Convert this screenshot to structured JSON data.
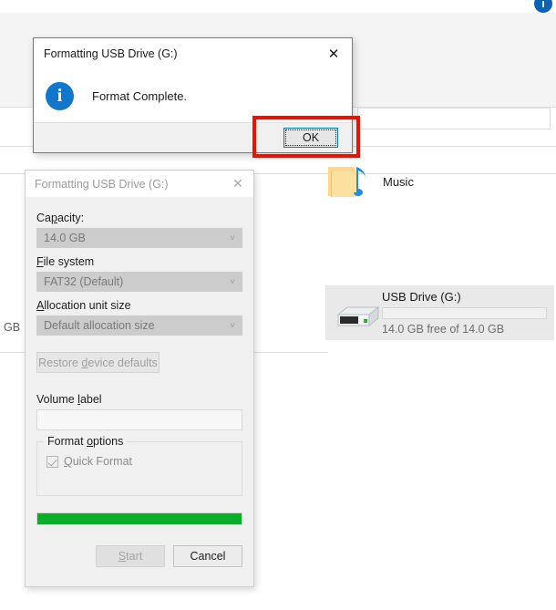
{
  "background": {
    "info_badge_icon": "info-circle-icon",
    "address_box_value": "",
    "left_fragment_text": "GB",
    "items": [
      {
        "name": "Music",
        "icon": "music-folder-icon",
        "selected": false
      }
    ],
    "drive": {
      "title": "USB Drive (G:)",
      "subtitle": "14.0 GB free of 14.0 GB",
      "icon": "removable-drive-icon",
      "usage_percent": 0,
      "selected": true
    }
  },
  "format_dialog": {
    "title": "Formatting USB Drive (G:)",
    "close_icon": "close-icon",
    "chevron_icon": "chevron-down-icon",
    "capacity": {
      "label": "Capacity:",
      "label_accel": "p",
      "value": "14.0 GB",
      "disabled": true
    },
    "file_system": {
      "label": "File system",
      "label_accel": "F",
      "value": "FAT32 (Default)",
      "disabled": true
    },
    "allocation_unit": {
      "label": "Allocation unit size",
      "label_accel": "A",
      "value": "Default allocation size",
      "disabled": true
    },
    "restore_defaults_label": "Restore device defaults",
    "restore_defaults_accel": "d",
    "volume_label": {
      "label": "Volume label",
      "label_accel": "l",
      "value": ""
    },
    "format_options": {
      "legend": "Format options",
      "legend_accel": "o",
      "quick_format": {
        "label": "Quick Format",
        "label_accel": "Q",
        "checked": true,
        "disabled": true
      }
    },
    "progress": {
      "percent": 100,
      "color": "#09af29"
    },
    "start_label": "Start",
    "start_accel": "S",
    "cancel_label": "Cancel"
  },
  "complete_dialog": {
    "title": "Formatting USB Drive (G:)",
    "close_icon": "close-icon",
    "info_icon": "info-icon",
    "info_icon_glyph": "i",
    "message": "Format Complete.",
    "ok_label": "OK",
    "annotation_color": "#f01000"
  }
}
